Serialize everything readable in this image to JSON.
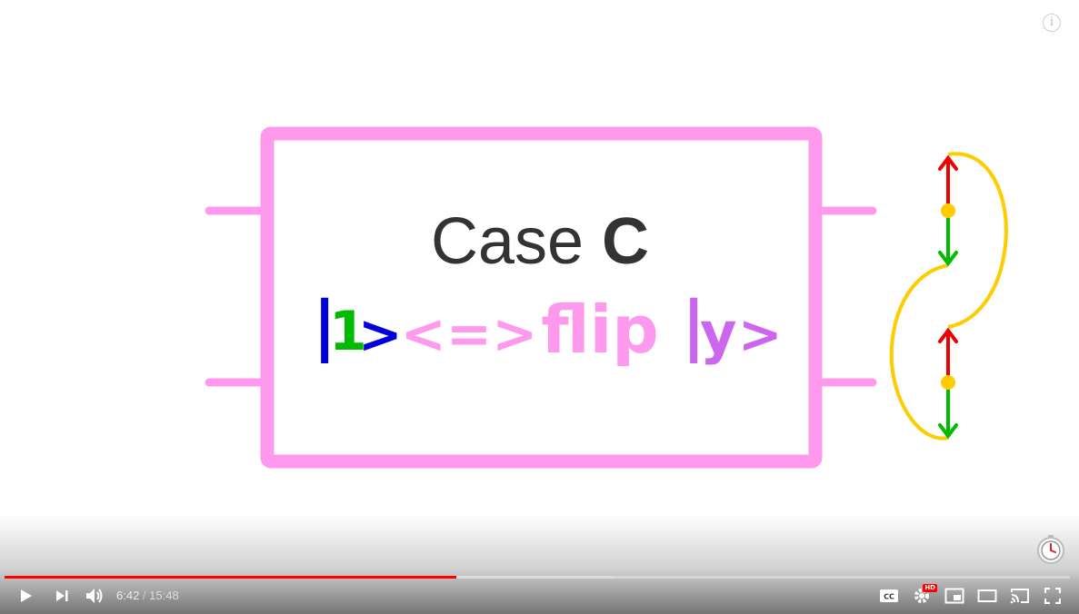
{
  "video": {
    "slide": {
      "title_plain": "Case",
      "title_bold": "C",
      "ket_open": "|",
      "ket_digit": "1",
      "ket_close": ">",
      "equiv": "<=>",
      "flip_word": "flip",
      "ket_y_open": "|",
      "ket_y_letter": "y",
      "ket_y_close": ">"
    },
    "colors": {
      "box": "#ff99ee",
      "title": "#333333",
      "ket_bar": "#0000dd",
      "ket_digit": "#00bb00",
      "equiv": "#ff99ee",
      "flip": "#ff99ee",
      "ket_y": "#cc66ee",
      "arc": "#ffcc00",
      "arrow_up": "#ee0000",
      "arrow_down": "#00bb00",
      "dot": "#ffcc00"
    },
    "info_icon": "i"
  },
  "player": {
    "progress": {
      "played_fraction": 0.4241,
      "buffered_fraction": 0.5717
    },
    "time": {
      "current": "6:42",
      "separator": " / ",
      "duration": "15:48"
    },
    "hd_badge": "HD",
    "icons": [
      "play-icon",
      "next-icon",
      "volume-icon",
      "captions-icon",
      "settings-icon",
      "miniplayer-icon",
      "theater-icon",
      "cast-icon",
      "fullscreen-icon",
      "watch-later-icon",
      "info-icon"
    ]
  }
}
